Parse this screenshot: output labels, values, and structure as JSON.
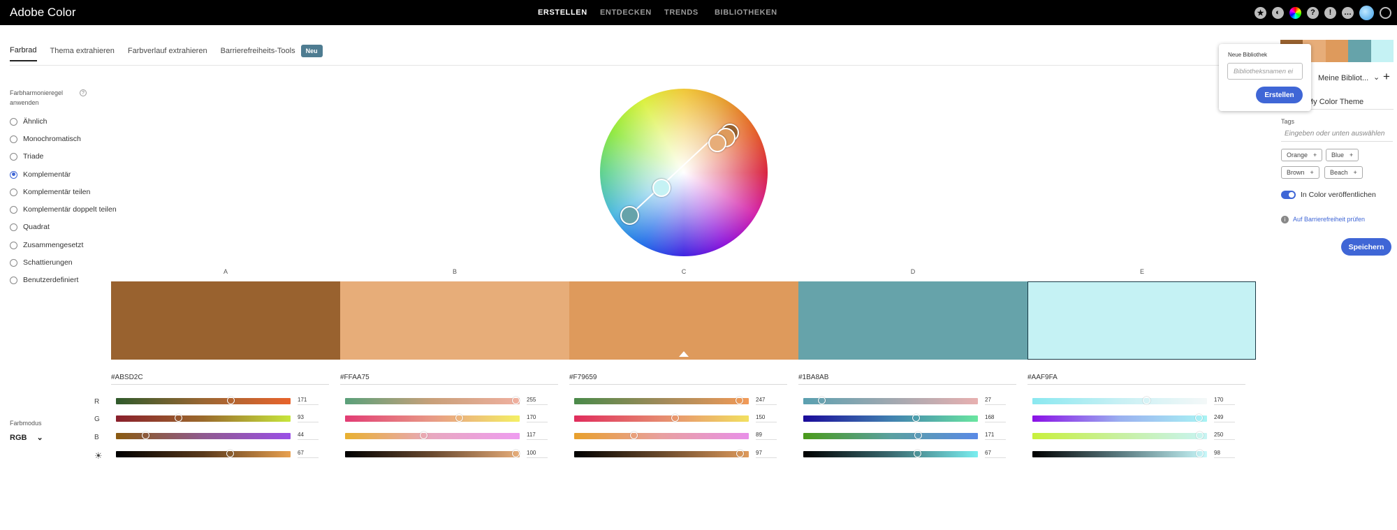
{
  "app": {
    "title": "Adobe Color"
  },
  "nav": [
    {
      "label": "ERSTELLEN",
      "active": true
    },
    {
      "label": "ENTDECKEN",
      "active": false
    },
    {
      "label": "TRENDS",
      "active": false
    },
    {
      "label": "BIBLIOTHEKEN",
      "active": false
    }
  ],
  "top_icons": [
    "star-icon",
    "contrast-icon",
    "color-wheel-icon",
    "help-icon",
    "alert-icon",
    "feedback-icon",
    "avatar",
    "creative-cloud-icon"
  ],
  "tabs": [
    "Farbrad",
    "Thema extrahieren",
    "Farbverlauf extrahieren",
    "Barrierefreiheits-Tools"
  ],
  "tab_badge": "Neu",
  "harmony": {
    "label": "Farbharmonieregel anwenden",
    "info_icon": "info-icon",
    "rules": [
      "Ähnlich",
      "Monochromatisch",
      "Triade",
      "Komplementär",
      "Komplementär teilen",
      "Komplementär doppelt teilen",
      "Quadrat",
      "Zusammengesetzt",
      "Schattierungen",
      "Benutzerdefiniert"
    ],
    "selected": "Komplementär"
  },
  "swatches": [
    {
      "label": "A",
      "hex": "#ABSD2C",
      "color": "#99622f"
    },
    {
      "label": "B",
      "hex": "#FFAA75",
      "color": "#e7ad79"
    },
    {
      "label": "C",
      "hex": "#F79659",
      "color": "#de9a5c"
    },
    {
      "label": "D",
      "hex": "#1BA8AB",
      "color": "#66a3aa"
    },
    {
      "label": "E",
      "hex": "#AAF9FA",
      "color": "#c5f2f4"
    }
  ],
  "selected_swatch": "C",
  "slider_row_labels": [
    "R",
    "G",
    "B",
    "brightness-icon"
  ],
  "slider_values": [
    [
      171,
      93,
      44,
      67
    ],
    [
      255,
      170,
      117,
      100
    ],
    [
      247,
      150,
      89,
      97
    ],
    [
      27,
      168,
      171,
      67
    ],
    [
      170,
      249,
      250,
      98
    ]
  ],
  "farbmodus": {
    "label": "Farbmodus",
    "value": "RGB"
  },
  "library": {
    "popover_title": "Neue Bibliothek",
    "input_placeholder": "Bibliotheksnamen ei",
    "create_button": "Erstellen",
    "select": "Meine Bibliot...",
    "theme_name": "My Color Theme",
    "tags_label": "Tags",
    "tags_placeholder": "Eingeben oder unten auswählen",
    "tags": [
      "Orange",
      "Blue",
      "Brown",
      "Beach"
    ],
    "publish_label": "In Color veröffentlichen",
    "a11y_link": "Auf Barrierefreiheit prüfen",
    "save_button": "Speichern"
  }
}
